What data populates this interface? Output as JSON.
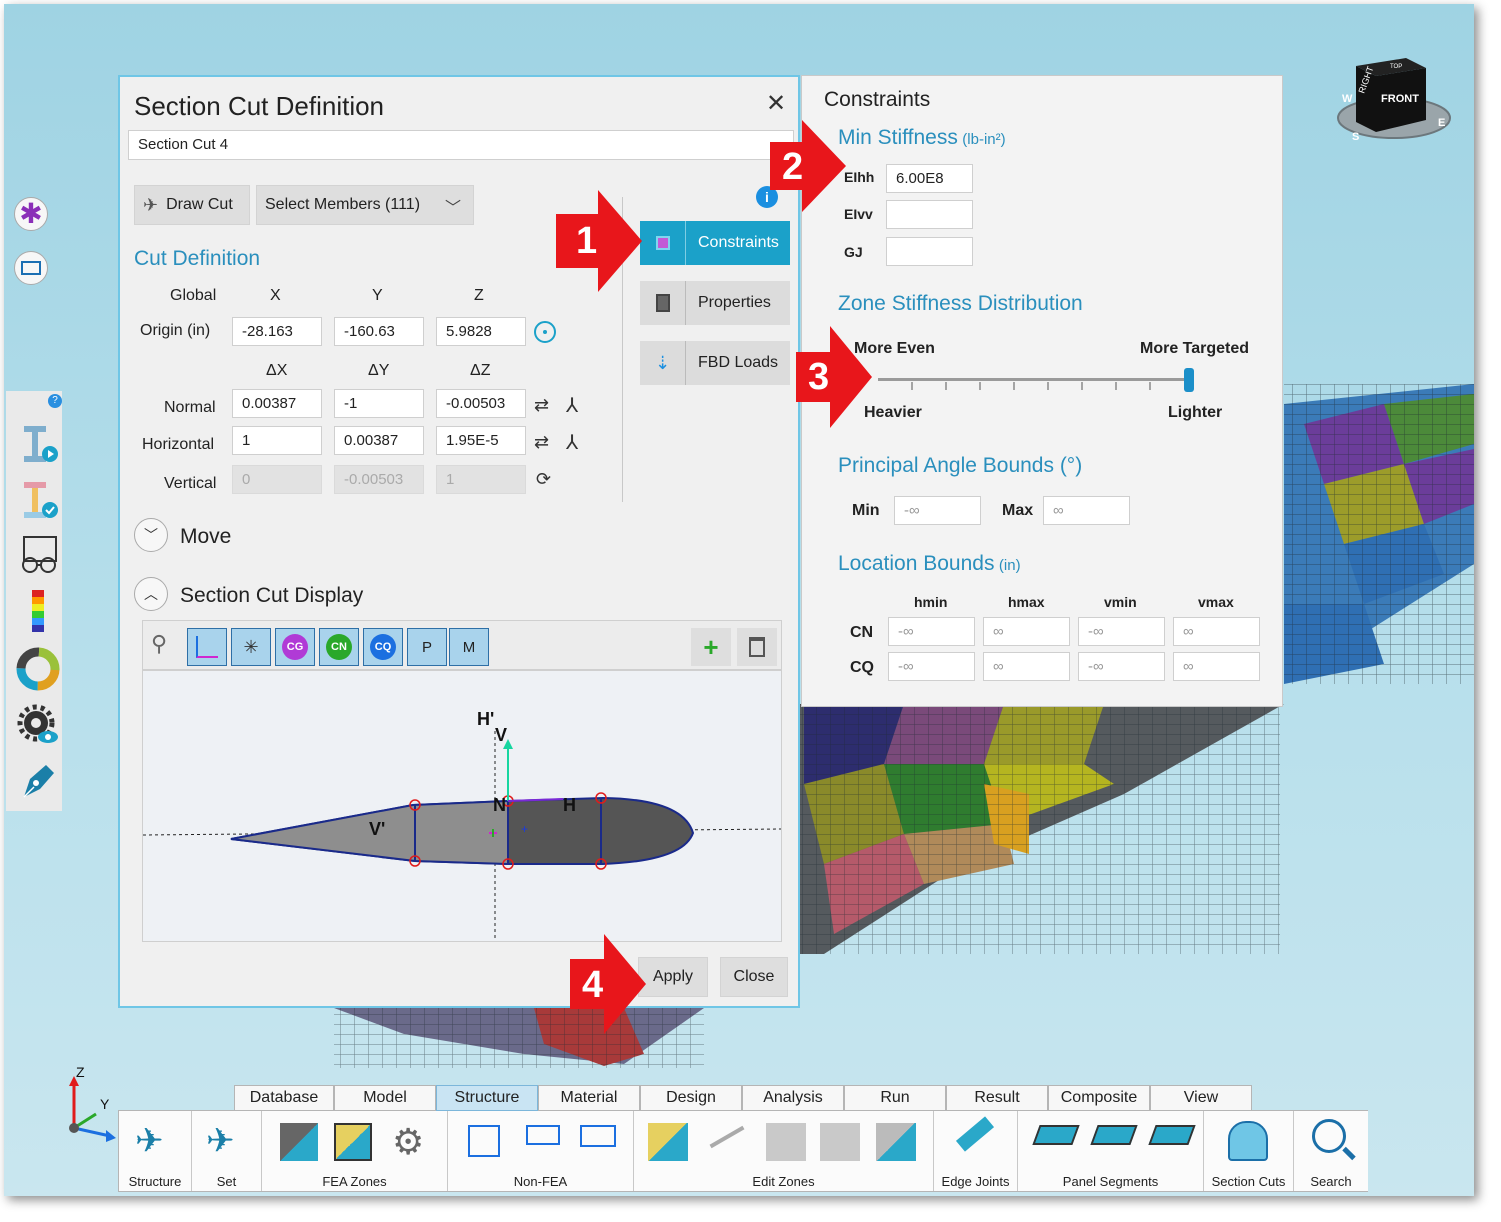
{
  "section_cut_dialog": {
    "title": "Section Cut Definition",
    "name_value": "Section Cut 4",
    "draw_cut_label": "Draw Cut",
    "select_members_label": "Select Members (111)",
    "cut_definition_heading": "Cut Definition",
    "col_global": "Global",
    "col_x": "X",
    "col_y": "Y",
    "col_z": "Z",
    "col_dx": "ΔX",
    "col_dy": "ΔY",
    "col_dz": "ΔZ",
    "origin_label": "Origin  (in)",
    "origin": [
      "-28.163",
      "-160.63",
      "5.9828"
    ],
    "normal_label": "Normal",
    "normal": [
      "0.00387",
      "-1",
      "-0.00503"
    ],
    "horizontal_label": "Horizontal",
    "horizontal": [
      "1",
      "0.00387",
      "1.95E-5"
    ],
    "vertical_label": "Vertical",
    "vertical": [
      "0",
      "-0.00503",
      "1"
    ],
    "move_label": "Move",
    "display_label": "Section Cut Display",
    "toolbar": {
      "cg": "CG",
      "cn": "CN",
      "cq": "CQ",
      "p": "P",
      "m": "M"
    },
    "plot_labels": {
      "h_prime": "H'",
      "v": "V",
      "n": "N",
      "h": "H",
      "v_prime": "V'"
    },
    "constraints_button": "Constraints",
    "properties_button": "Properties",
    "fbd_loads_button": "FBD Loads",
    "apply_button": "Apply",
    "close_button": "Close"
  },
  "constraints_panel": {
    "title": "Constraints",
    "min_stiffness_heading": "Min Stiffness",
    "min_stiffness_unit": "(lb-in²)",
    "ei_hh_label": "EIhh",
    "ei_hh_value": "6.00E8",
    "ei_vv_label": "EIvv",
    "ei_vv_value": "",
    "gj_label": "GJ",
    "gj_value": "",
    "zone_heading": "Zone Stiffness Distribution",
    "more_even": "More Even",
    "more_targeted": "More Targeted",
    "heavier": "Heavier",
    "lighter": "Lighter",
    "slider_value": 1.0,
    "angle_heading": "Principal Angle Bounds (°)",
    "min_label": "Min",
    "min_value": "-∞",
    "max_label": "Max",
    "max_value": "∞",
    "location_heading": "Location Bounds",
    "location_unit": "(in)",
    "loc_cols": [
      "hmin",
      "hmax",
      "vmin",
      "vmax"
    ],
    "rows": [
      {
        "label": "CN",
        "values": [
          "-∞",
          "∞",
          "-∞",
          "∞"
        ]
      },
      {
        "label": "CQ",
        "values": [
          "-∞",
          "∞",
          "-∞",
          "∞"
        ]
      }
    ]
  },
  "steps": [
    "1",
    "2",
    "3",
    "4"
  ],
  "view_cube": {
    "front": "FRONT",
    "right": "RIGHT",
    "top": "TOP",
    "w": "W",
    "s": "S",
    "e": "E"
  },
  "axis": {
    "z": "Z",
    "y": "Y"
  },
  "ribbon_tabs": [
    "Database",
    "Model",
    "Structure",
    "Material",
    "Design",
    "Analysis",
    "Run",
    "Result",
    "Composite",
    "View"
  ],
  "ribbon_groups": {
    "structure": "Structure",
    "set": "Set",
    "fea_zones": "FEA Zones",
    "non_fea": "Non-FEA",
    "edit_zones": "Edit Zones",
    "edge_joints": "Edge Joints",
    "panel_segments": "Panel Segments",
    "section_cuts": "Section Cuts",
    "search": "Search"
  },
  "colors": {
    "accent": "#1ba1c9",
    "heading": "#2a8fbd",
    "marker": "#e8161b"
  }
}
